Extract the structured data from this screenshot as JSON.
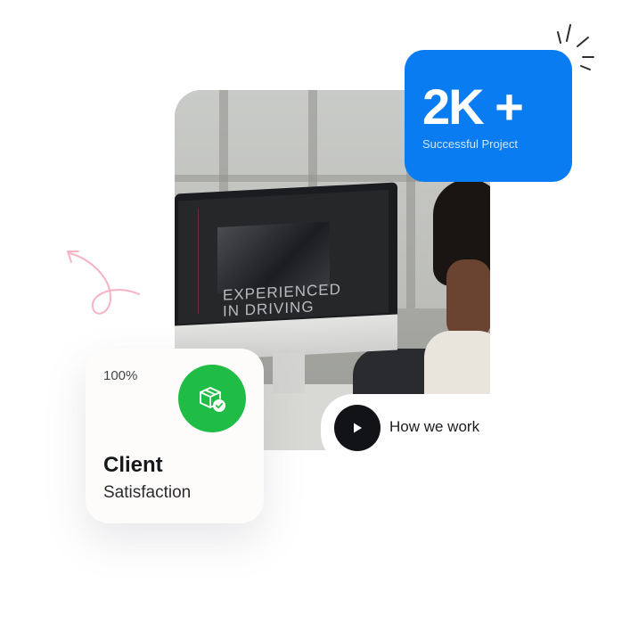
{
  "stat": {
    "value": "2K +",
    "label": "Successful Project",
    "color": "#0a7cf2"
  },
  "satisfaction": {
    "percent": "100%",
    "title": "Client",
    "subtitle": "Satisfaction",
    "badge_icon": "package-check-icon",
    "badge_color": "#1fbd45"
  },
  "video": {
    "label": "How we work",
    "icon": "play-icon"
  },
  "photo": {
    "screen_headline_1": "EXPERIENCED",
    "screen_headline_2": "IN DRIVING"
  }
}
